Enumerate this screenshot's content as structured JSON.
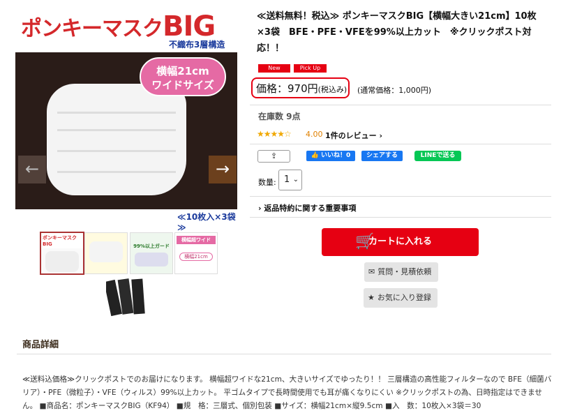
{
  "image": {
    "brand_text": "ポンキーマスク",
    "brand_big": "BIG",
    "sub": "不織布3層構造",
    "badge_line1": "横幅21cm",
    "badge_line2": "ワイドサイズ",
    "caption": "≪10枚入×3袋≫",
    "arrow_left": "←",
    "arrow_right": "→"
  },
  "thumbs": {
    "t1_label": "ポンキーマスクBIG",
    "t3_label": "99%以上ガード",
    "t4_label1": "横幅超ワイド",
    "t4_label2": "横幅21cm"
  },
  "product": {
    "title": "≪送料無料！税込≫ ポンキーマスクBIG【横幅大きい21cm】10枚×3袋　BFE・PFE・VFEを99%以上カット　※クリックポスト対応！！",
    "tag_new": "New",
    "tag_pickup": "Pick Up",
    "price_label": "価格：970円",
    "price_tax": "(税込み)",
    "regular_price": "(通常価格：1,000円)",
    "stock": "在庫数 9点",
    "stars": "★★★★☆",
    "rating": "4.00",
    "reviews": "1件のレビュー ›",
    "share_icon": "⇪",
    "fb_like": "👍 いいね！0",
    "fb_share": "シェアする",
    "line_share": "LINEで送る",
    "qty_label": "数量:",
    "qty_value": "1",
    "qty_chevron": "⌄",
    "returns": "› 返品特約に関する重要事項",
    "cart_icon": "🛒",
    "cart_label": "カートに入れる",
    "inquiry_icon": "✉",
    "inquiry_label": "質問・見積依頼",
    "fav_icon": "★",
    "fav_label": "お気に入り登録"
  },
  "details": {
    "heading": "商品詳細",
    "text": "≪送料込価格≫クリックポストでのお届けになります。 横幅超ワイドな21cm、大きいサイズでゆったり！！ 三層構造の高性能フィルターなので BFE（細菌バリア）・PFE（微粒子）・VFE（ウィルス）99%以上カット。 平ゴムタイプで長時間使用でも耳が痛くなりにくい ※クリックポストの為、日時指定はできません。 ■商品名：ポンキーマスクBIG（KF94） ■規　格：三層式、個別包装 ■サイズ：横幅21cm×縦9.5cm ■入　数：10枚入×3袋＝30"
  },
  "colors": {
    "accent_red": "#e60012",
    "brand_red": "#d4282b",
    "facebook": "#1877f2",
    "line": "#06c755"
  }
}
